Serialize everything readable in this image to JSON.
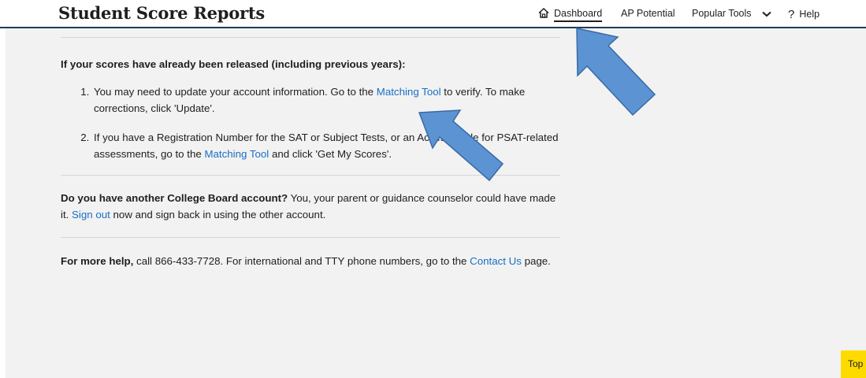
{
  "header": {
    "title": "Student Score Reports",
    "nav": {
      "dashboard": "Dashboard",
      "ap_potential": "AP Potential",
      "popular_tools": "Popular Tools",
      "help": "Help",
      "help_glyph": "?"
    }
  },
  "content": {
    "released_heading": "If your scores have already been released (including previous years):",
    "step1": {
      "number": "1.",
      "text_before": "You may need to update your account information. Go to the ",
      "link": "Matching Tool",
      "text_after": " to verify. To make corrections, click 'Update'."
    },
    "step2": {
      "number": "2.",
      "text_before": "If you have a Registration Number for the SAT or Subject Tests, or an Access Code for PSAT-related assessments, go to the ",
      "link": "Matching Tool",
      "text_after": " and click 'Get My Scores'."
    },
    "account": {
      "bold": "Do you have another College Board account?",
      "text": " You, your parent or guidance counselor could have made it. ",
      "link": "Sign out",
      "text_after": " now and sign back in using the other account."
    },
    "help": {
      "bold": "For more help,",
      "text": " call 866-433-7728. For international and TTY phone numbers, go to the ",
      "link": "Contact Us",
      "text_after": " page."
    }
  },
  "top_button": "Top",
  "icons": {
    "dashboard": "home-icon",
    "popular_tools": "chevron-down-icon",
    "help": "question-mark-icon"
  },
  "colors": {
    "link": "#1a6fc4",
    "header_rule": "#1c3c5c",
    "top_button": "#fedb00",
    "annotation_arrow": "#5b93d3",
    "annotation_outline": "#3a6aa5"
  }
}
